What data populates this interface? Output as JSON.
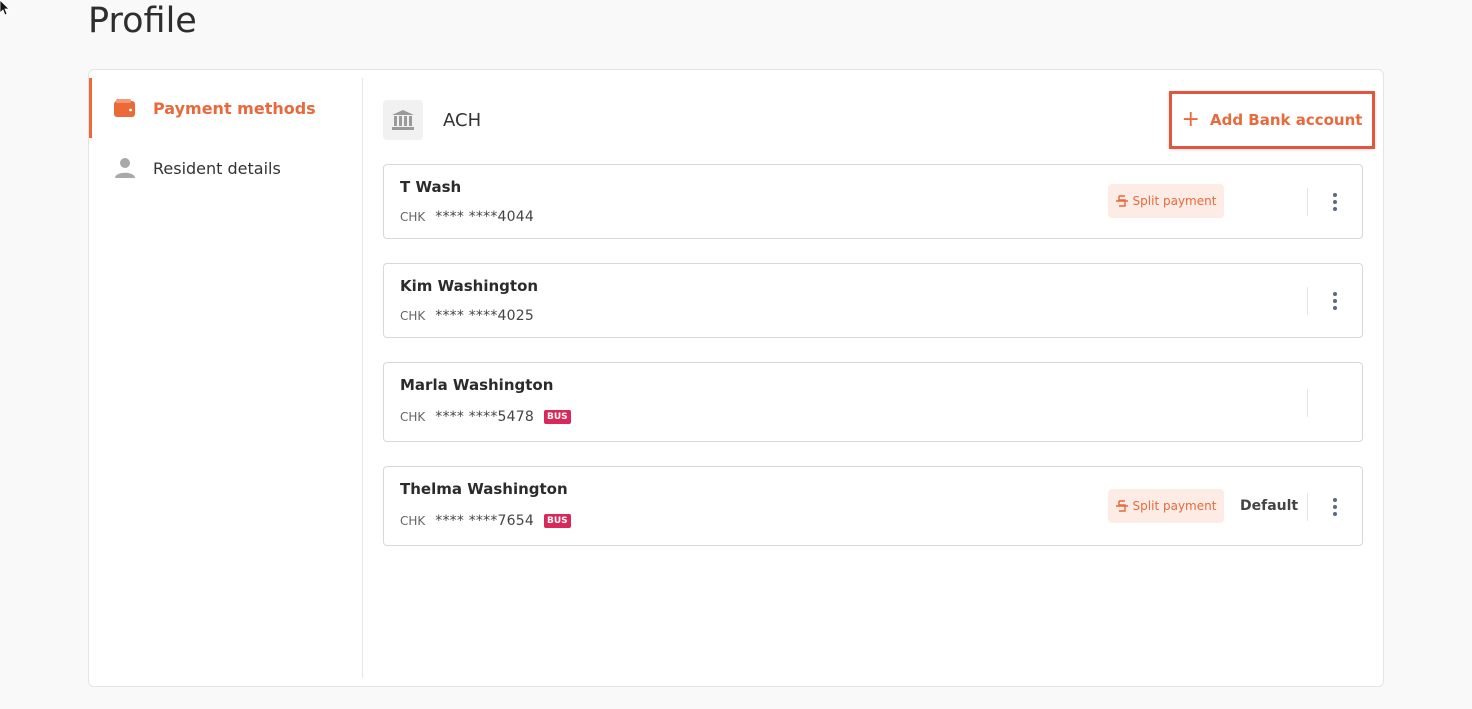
{
  "page": {
    "title": "Profile"
  },
  "sidebar": {
    "items": [
      {
        "label": "Payment methods",
        "icon": "wallet-icon",
        "active": true
      },
      {
        "label": "Resident details",
        "icon": "person-icon",
        "active": false
      }
    ]
  },
  "section": {
    "title": "ACH",
    "icon": "bank-icon",
    "add_button_label": "Add Bank account"
  },
  "accounts": [
    {
      "name": "T Wash",
      "type": "CHK",
      "number": "**** ****4044",
      "split_label": "Split payment",
      "bus_label": "",
      "default_label": ""
    },
    {
      "name": "Kim Washington",
      "type": "CHK",
      "number": "**** ****4025",
      "split_label": "",
      "bus_label": "",
      "default_label": ""
    },
    {
      "name": "Marla Washington",
      "type": "CHK",
      "number": "**** ****5478",
      "split_label": "",
      "bus_label": "BUS",
      "default_label": ""
    },
    {
      "name": "Thelma Washington",
      "type": "CHK",
      "number": "**** ****7654",
      "split_label": "Split payment",
      "bus_label": "BUS",
      "default_label": "Default"
    }
  ],
  "colors": {
    "accent": "#e8693c",
    "highlight_border": "#e3563d",
    "bus_badge": "#d9295a",
    "split_bg": "#fdece6"
  }
}
